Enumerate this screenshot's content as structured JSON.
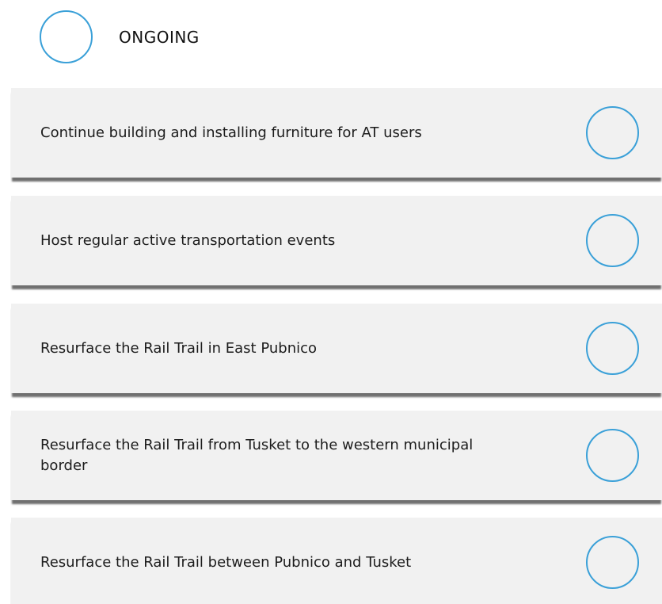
{
  "header": {
    "title": "ONGOING",
    "icon": "circle-outline-icon"
  },
  "colors": {
    "accent": "#3aa0d8",
    "card_background": "#f1f1f1",
    "card_shadow": "#707070",
    "text": "#1c1c1c"
  },
  "tasks": [
    {
      "label": "Continue building and installing furniture for AT users",
      "completed": false
    },
    {
      "label": "Host regular active transportation events",
      "completed": false
    },
    {
      "label": "Resurface the Rail Trail in East Pubnico",
      "completed": false
    },
    {
      "label": "Resurface the Rail Trail from Tusket to the western municipal border",
      "completed": false
    },
    {
      "label": "Resurface the Rail Trail between Pubnico and Tusket",
      "completed": false
    }
  ]
}
